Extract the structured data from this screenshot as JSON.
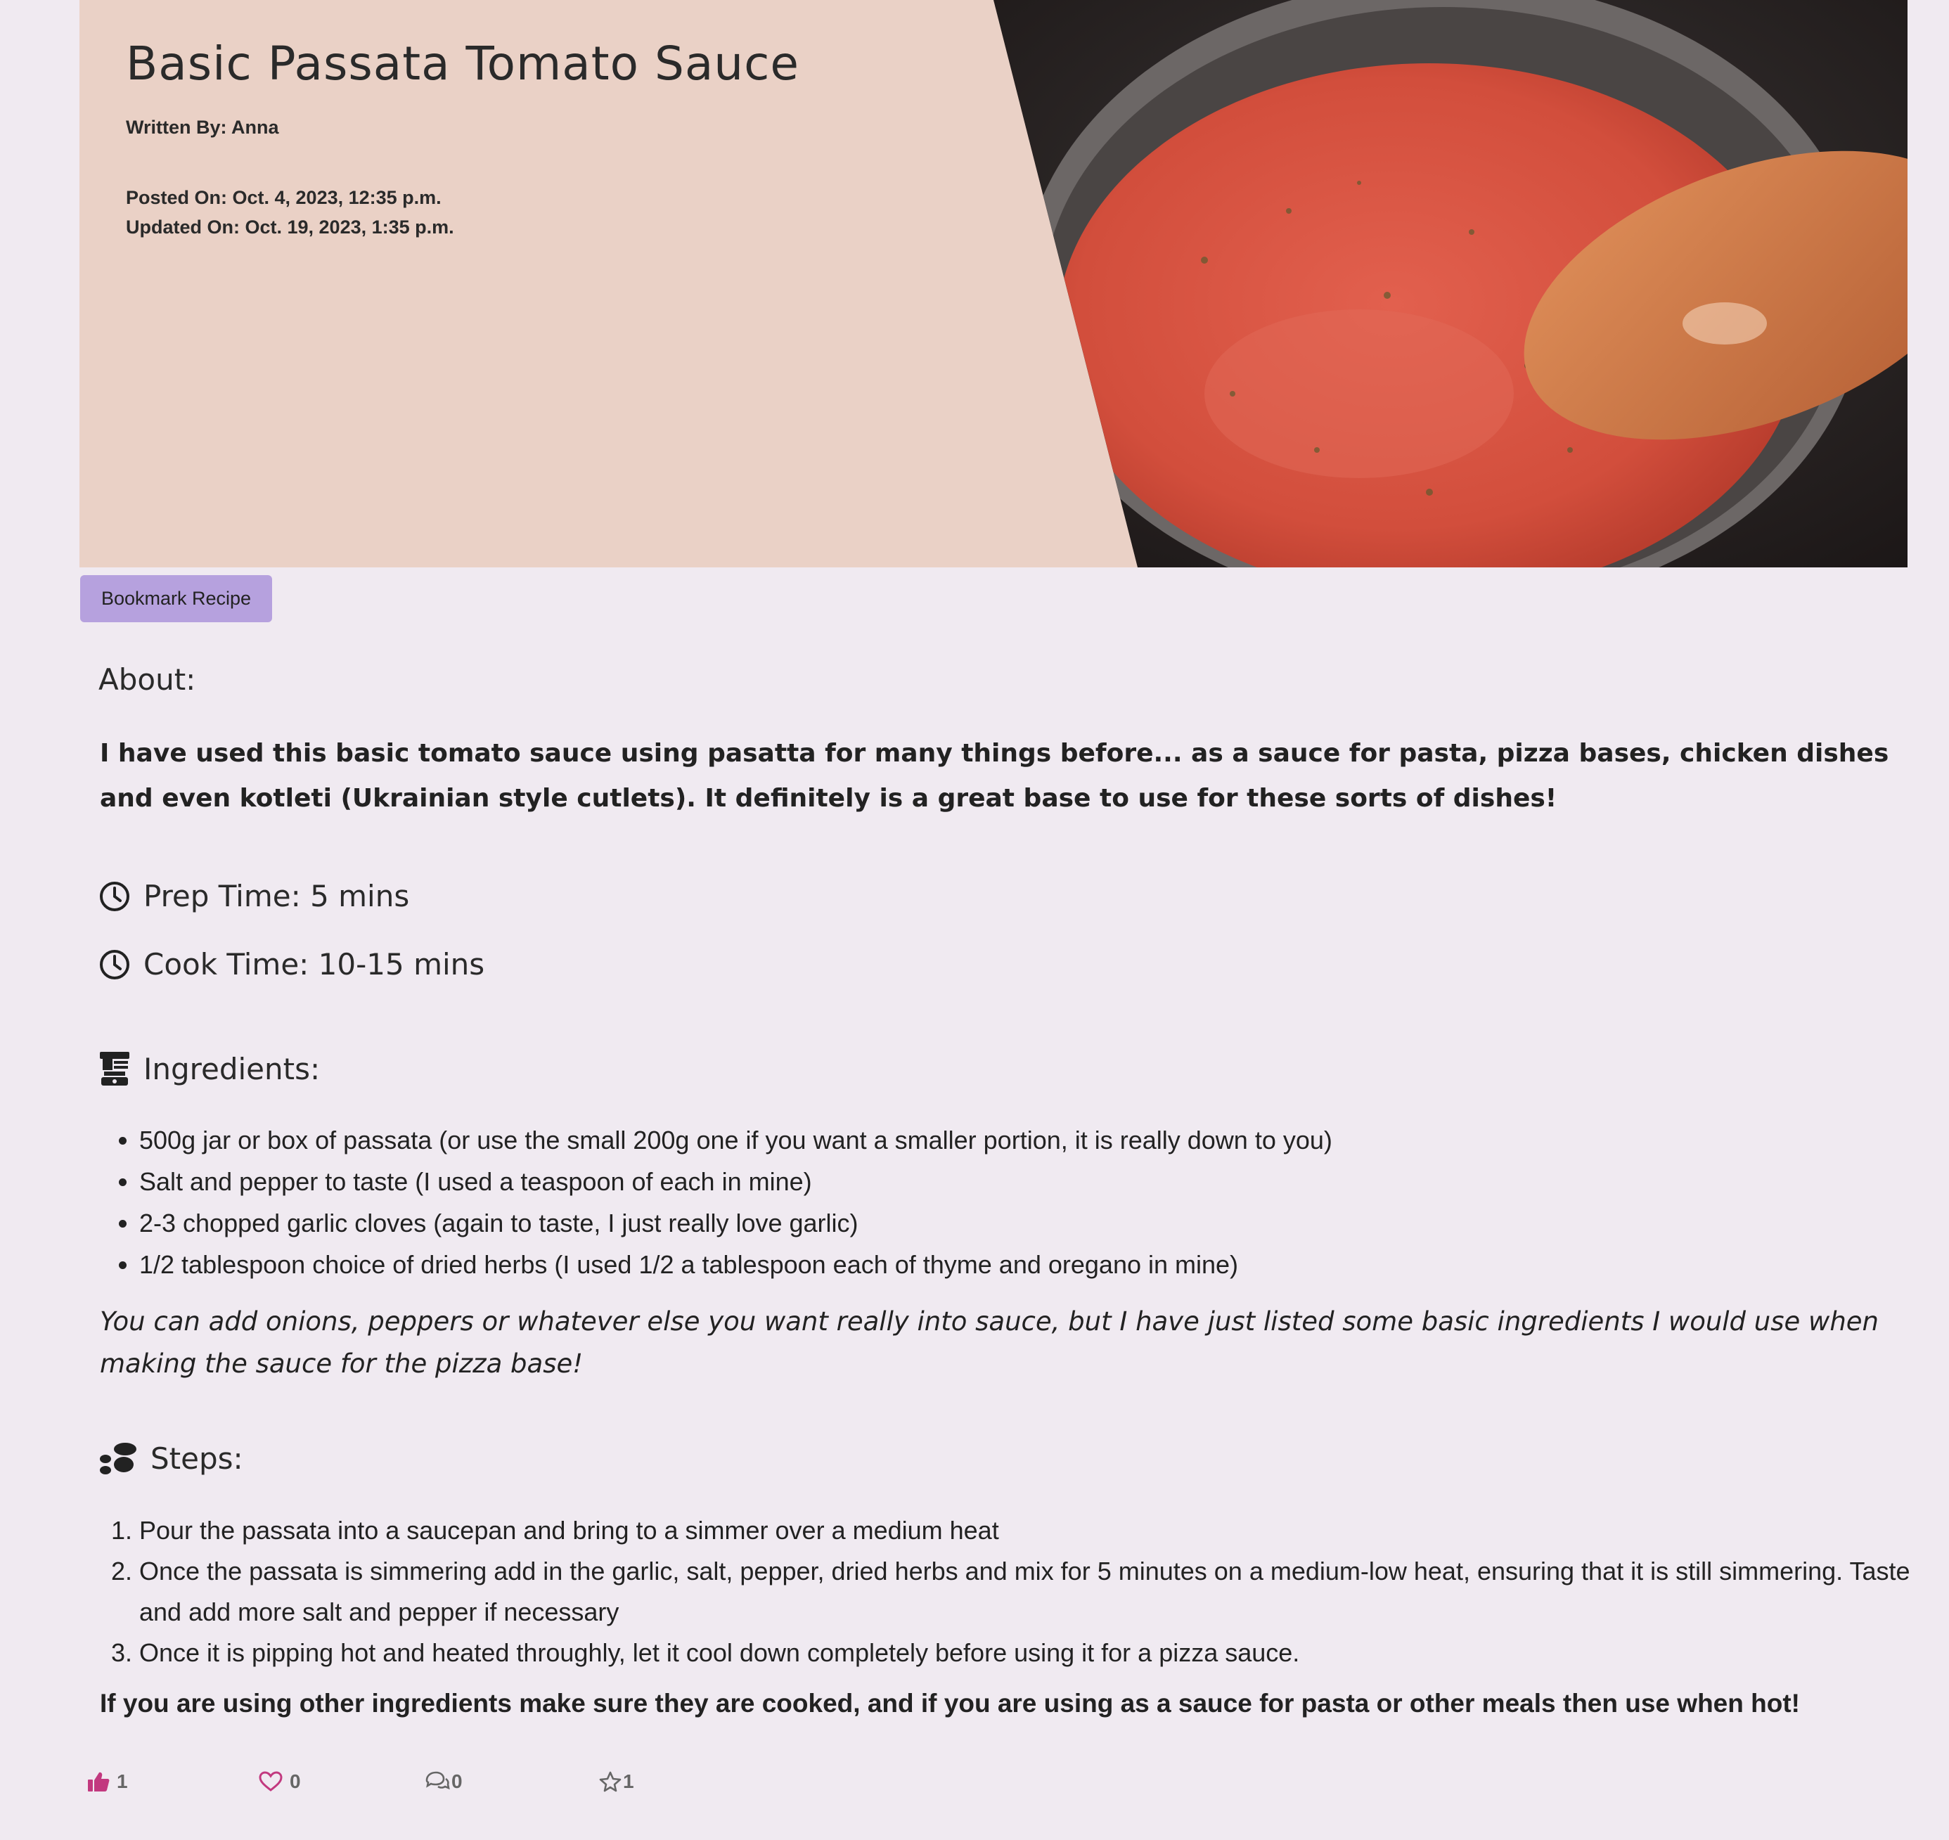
{
  "recipe": {
    "title": "Basic Passata Tomato Sauce",
    "author": "Written By: Anna",
    "posted": "Posted On: Oct. 4, 2023, 12:35 p.m.",
    "updated": "Updated On: Oct. 19, 2023, 1:35 p.m."
  },
  "actions": {
    "bookmark_label": "Bookmark Recipe"
  },
  "about": {
    "heading": "About:",
    "text": "I have used this basic tomato sauce using pasatta for many things before... as a sauce for pasta, pizza bases, chicken dishes and even kotleti (Ukrainian style cutlets). It definitely is a great base to use for these sorts of dishes!"
  },
  "times": {
    "prep": "Prep Time: 5 mins",
    "cook": "Cook Time: 10-15 mins",
    "icon": "clock-icon"
  },
  "ingredients": {
    "heading": "Ingredients:",
    "icon": "blender-icon",
    "items": [
      "500g jar or box of passata (or use the small 200g one if you want a smaller portion, it is really down to you)",
      "Salt and pepper to taste (I used a teaspoon of each in mine)",
      "2-3 chopped garlic cloves (again to taste, I just really love garlic)",
      "1/2 tablespoon choice of dried herbs (I used 1/2 a tablespoon each of thyme and oregano in mine)"
    ],
    "note": "You can add onions, peppers or whatever else you want really into sauce, but I have just listed some basic ingredients I would use when making the sauce for the pizza base!"
  },
  "steps": {
    "heading": "Steps:",
    "icon": "footprints-icon",
    "items": [
      "Pour the passata into a saucepan and bring to a simmer over a medium heat",
      "Once the passata is simmering add in the garlic, salt, pepper, dried herbs and mix for 5 minutes on a medium-low heat, ensuring that it is still simmering. Taste and add more salt and pepper if necessary",
      "Once it is pipping hot and heated throughly, let it cool down completely before using it for a pizza sauce."
    ],
    "final_note": "If you are using other ingredients make sure they are cooked, and if you are using as a sauce for pasta or other meals then use when hot!"
  },
  "reactions": {
    "likes": "1",
    "favourites": "0",
    "comments": "0",
    "stars": "1",
    "like_color": "#c2397f",
    "heart_color": "#c2397f"
  }
}
